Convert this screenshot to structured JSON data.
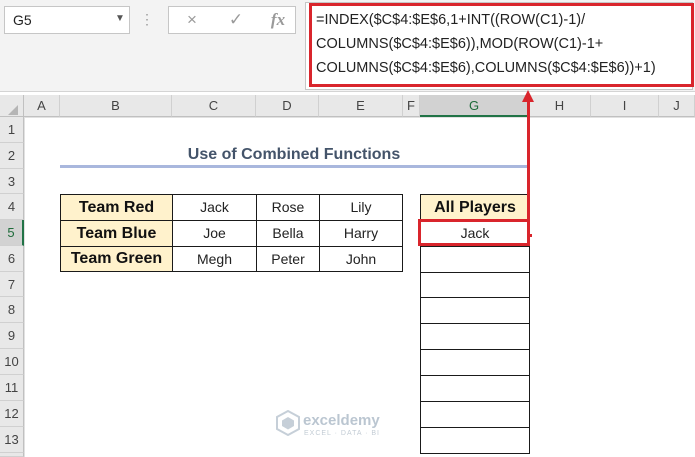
{
  "name_box": {
    "value": "G5"
  },
  "formula_bar": {
    "formula": "=INDEX($C$4:$E$6,1+INT((ROW(C1)-1)/\nCOLUMNS($C$4:$E$6)),MOD(ROW(C1)-1+\nCOLUMNS($C$4:$E$6),COLUMNS($C$4:$E$6))+1)",
    "cancel_icon": "×",
    "enter_icon": "✓",
    "fx_label": "fx"
  },
  "columns": [
    "A",
    "B",
    "C",
    "D",
    "E",
    "F",
    "G",
    "H",
    "I",
    "J"
  ],
  "rows": [
    "1",
    "2",
    "3",
    "4",
    "5",
    "6",
    "7",
    "8",
    "9",
    "10",
    "11",
    "12",
    "13"
  ],
  "sheet": {
    "title": "Use of Combined Functions",
    "teams": [
      {
        "name": "Team Red",
        "players": [
          "Jack",
          "Rose",
          "Lily"
        ]
      },
      {
        "name": "Team Blue",
        "players": [
          "Joe",
          "Bella",
          "Harry"
        ]
      },
      {
        "name": "Team Green",
        "players": [
          "Megh",
          "Peter",
          "John"
        ]
      }
    ],
    "all_players_header": "All Players",
    "all_players": [
      "Jack",
      "",
      "",
      "",
      "",
      "",
      "",
      "",
      ""
    ]
  },
  "watermark": {
    "name": "exceldemy",
    "tagline": "EXCEL · DATA · BI"
  },
  "colors": {
    "accent_red": "#d9252c",
    "team_fill": "#fff2cc",
    "title_text": "#44546a",
    "excel_green": "#217346"
  }
}
